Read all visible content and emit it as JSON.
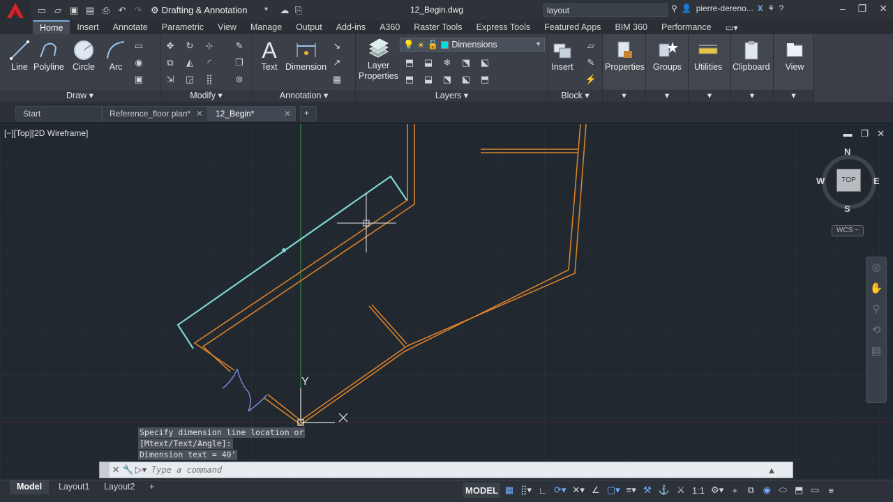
{
  "titlebar": {
    "app_logo": "A",
    "workspace": "Drafting & Annotation",
    "document_title": "12_Begin.dwg",
    "search_value": "layout",
    "user_name": "pierre-dereno..."
  },
  "ribbon_tabs": [
    "Home",
    "Insert",
    "Annotate",
    "Parametric",
    "View",
    "Manage",
    "Output",
    "Add-ins",
    "A360",
    "Raster Tools",
    "Express Tools",
    "Featured Apps",
    "BIM 360",
    "Performance"
  ],
  "ribbon": {
    "draw": {
      "title": "Draw",
      "line": "Line",
      "polyline": "Polyline",
      "circle": "Circle",
      "arc": "Arc"
    },
    "modify": {
      "title": "Modify"
    },
    "annotation": {
      "title": "Annotation",
      "text": "Text",
      "dimension": "Dimension"
    },
    "layers": {
      "title": "Layers",
      "layer_properties": "Layer\nProperties",
      "current_layer": "Dimensions",
      "current_layer_color": "#00e0e0"
    },
    "block": {
      "title": "Block",
      "insert": "Insert"
    },
    "properties": "Properties",
    "groups": "Groups",
    "utilities": "Utilities",
    "clipboard": "Clipboard",
    "view": "View"
  },
  "doc_tabs": [
    {
      "label": "Start"
    },
    {
      "label": "Reference_floor plan*"
    },
    {
      "label": "12_Begin*"
    }
  ],
  "viewport": {
    "label": "[−][Top][2D Wireframe]",
    "viewcube": {
      "top": "TOP",
      "n": "N",
      "s": "S",
      "e": "E",
      "w": "W"
    },
    "wcs": "WCS −",
    "ucs_y": "Y"
  },
  "command": {
    "history": [
      "Specify dimension line location or",
      "[Mtext/Text/Angle]:",
      "Dimension text = 40'"
    ],
    "placeholder": "Type a command"
  },
  "layout_tabs": [
    "Model",
    "Layout1",
    "Layout2"
  ],
  "status": {
    "model": "MODEL",
    "scale": "1:1"
  },
  "colors": {
    "walls": "#d9822b",
    "dimension": "#7fd6d3",
    "door": "#7a8fe0",
    "ucs_y_axis": "#2f9f3f"
  }
}
